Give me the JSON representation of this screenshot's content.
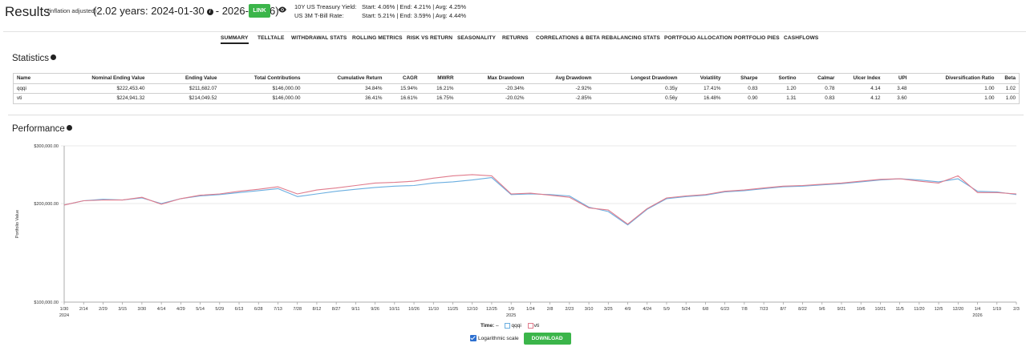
{
  "header": {
    "title": "Results",
    "subnote": "(inflation adjusted)",
    "date_range_left": "(2.02 years: 2024-01-30",
    "date_range_right": "- 2026-02-06)",
    "link_label": "LINK",
    "treasury_label": "10Y US Treasury Yield:",
    "treasury_values": "Start: 4.06% | End: 4.21% | Avg: 4.25%",
    "tbill_label": "US 3M T-Bill Rate:",
    "tbill_values": "Start: 5.21% | End: 3.59% | Avg: 4.44%"
  },
  "tabs": [
    "SUMMARY",
    "TELLTALE",
    "WITHDRAWAL STATS",
    "ROLLING METRICS",
    "RISK VS RETURN",
    "SEASONALITY",
    "RETURNS",
    "CORRELATIONS & BETA",
    "REBALANCING STATS",
    "PORTFOLIO ALLOCATION",
    "PORTFOLIO PIES",
    "CASHFLOWS"
  ],
  "statistics": {
    "title": "Statistics",
    "columns": [
      "Name",
      "Nominal Ending Value",
      "Ending Value",
      "Total Contributions",
      "Cumulative Return",
      "CAGR",
      "MWRR",
      "Max Drawdown",
      "Avg Drawdown",
      "Longest Drawdown",
      "Volatility",
      "Sharpe",
      "Sortino",
      "Calmar",
      "Ulcer Index",
      "UPI",
      "Diversification Ratio",
      "Beta"
    ],
    "rows": [
      [
        "qqqi",
        "$222,453.40",
        "$211,682.07",
        "$146,000.00",
        "34.84%",
        "15.94%",
        "16.21%",
        "-20.34%",
        "-2.92%",
        "0.35y",
        "17.41%",
        "0.83",
        "1.20",
        "0.78",
        "4.14",
        "3.48",
        "1.00",
        "1.02"
      ],
      [
        "vti",
        "$224,941.32",
        "$214,049.52",
        "$146,000.00",
        "36.41%",
        "16.61%",
        "16.75%",
        "-20.02%",
        "-2.85%",
        "0.56y",
        "16.48%",
        "0.90",
        "1.31",
        "0.83",
        "4.12",
        "3.60",
        "1.00",
        "1.00"
      ]
    ]
  },
  "performance": {
    "title": "Performance",
    "legend_time": "Time:",
    "legend_dash": "–",
    "log_label": "Logarithmic scale",
    "download_label": "DOWNLOAD"
  },
  "colors": {
    "qqqi": "#6aaee0",
    "vti": "#e07b8c",
    "button_green": "#3bb54a"
  },
  "chart_data": {
    "type": "line",
    "ylabel": "Portfolio Value",
    "y_scale": "log",
    "ylim": [
      100000,
      300000
    ],
    "y_ticks": [
      "$300,000.00",
      "$200,000.00",
      "$100,000.00"
    ],
    "x_ticks": [
      "1/30",
      "2/14",
      "2/29",
      "3/15",
      "3/30",
      "4/14",
      "4/29",
      "5/14",
      "5/29",
      "6/13",
      "6/28",
      "7/13",
      "7/28",
      "8/12",
      "8/27",
      "9/11",
      "9/26",
      "10/11",
      "10/26",
      "11/10",
      "11/25",
      "12/10",
      "12/25",
      "1/9",
      "1/24",
      "2/8",
      "2/23",
      "3/10",
      "3/25",
      "4/9",
      "4/24",
      "5/9",
      "5/24",
      "6/8",
      "6/23",
      "7/8",
      "7/23",
      "8/7",
      "8/22",
      "9/6",
      "9/21",
      "10/6",
      "10/21",
      "11/5",
      "11/20",
      "12/5",
      "12/20",
      "1/4",
      "1/19",
      "2/3"
    ],
    "year_labels": [
      {
        "label": "2024",
        "tick_index": 0
      },
      {
        "label": "2025",
        "tick_index": 23
      },
      {
        "label": "2026",
        "tick_index": 47
      }
    ],
    "series": [
      {
        "name": "qqqi",
        "values": [
          198000,
          204000,
          206000,
          205000,
          208000,
          200000,
          207000,
          211000,
          213000,
          216000,
          219000,
          222000,
          210000,
          214000,
          218000,
          221000,
          224000,
          226000,
          227000,
          231000,
          233000,
          236000,
          240000,
          213000,
          214000,
          213000,
          211000,
          195000,
          189000,
          172000,
          192000,
          207000,
          210000,
          212000,
          217000,
          219000,
          222000,
          225000,
          226000,
          228000,
          230000,
          233000,
          236000,
          238000,
          236000,
          233000,
          238000,
          218000,
          217000,
          213000
        ]
      },
      {
        "name": "vti",
        "values": [
          198000,
          204000,
          205000,
          205000,
          209000,
          199000,
          207000,
          212000,
          214000,
          218000,
          221000,
          225000,
          214000,
          220000,
          223000,
          227000,
          231000,
          232000,
          234000,
          239000,
          243000,
          245000,
          243000,
          214000,
          215000,
          212000,
          209000,
          194000,
          191000,
          173000,
          193000,
          208000,
          211000,
          213000,
          218000,
          220000,
          223000,
          226000,
          227000,
          229000,
          231000,
          234000,
          237000,
          238000,
          234000,
          231000,
          243000,
          216000,
          216000,
          214000
        ]
      }
    ]
  }
}
